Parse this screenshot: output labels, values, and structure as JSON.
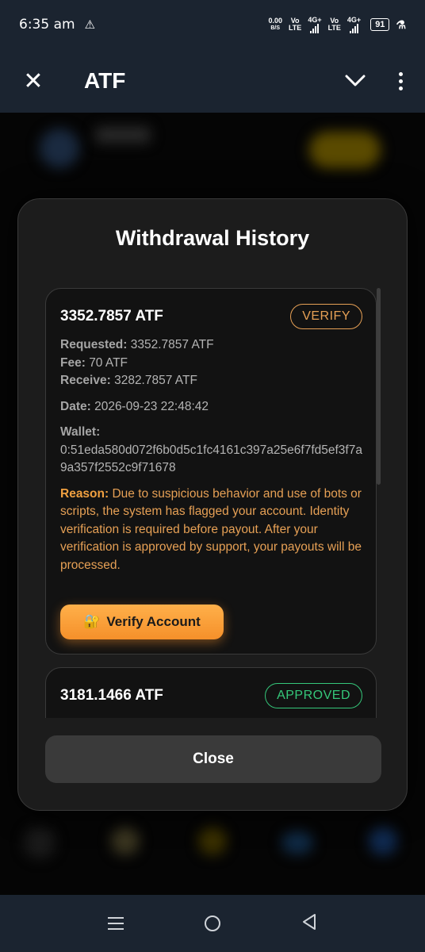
{
  "status_bar": {
    "time": "6:35 am",
    "warning_icon": "warning-icon",
    "net_speed_value": "0.00",
    "net_speed_unit": "B/S",
    "volte1_top": "Vo",
    "volte1_bottom": "LTE",
    "signal1_label": "4G+",
    "volte2_top": "Vo",
    "volte2_bottom": "LTE",
    "signal2_label": "4G+",
    "battery": "91"
  },
  "app_bar": {
    "title": "ATF"
  },
  "modal": {
    "title": "Withdrawal History",
    "close_label": "Close"
  },
  "withdrawals": [
    {
      "amount": "3352.7857 ATF",
      "status": "VERIFY",
      "requested_label": "Requested:",
      "requested": "3352.7857 ATF",
      "fee_label": "Fee:",
      "fee": "70 ATF",
      "receive_label": "Receive:",
      "receive": "3282.7857 ATF",
      "date_label": "Date:",
      "date": "2026-09-23 22:48:42",
      "wallet_label": "Wallet:",
      "wallet": "0:51eda580d072f6b0d5c1fc4161c397a25e6f7fd5ef3f7a9a357f2552c9f71678",
      "reason_label": "Reason:",
      "reason": "Due to suspicious behavior and use of bots or scripts, the system has flagged your account. Identity verification is required before payout. After your verification is approved by support, your payouts will be processed.",
      "verify_button": "Verify Account",
      "verify_icon": "🔐"
    },
    {
      "amount": "3181.1466 ATF",
      "status": "APPROVED"
    }
  ],
  "colors": {
    "accent_orange": "#f5902a",
    "approved_green": "#35c77a",
    "modal_bg": "#1c1c1c",
    "bar_bg": "#1b2430"
  }
}
